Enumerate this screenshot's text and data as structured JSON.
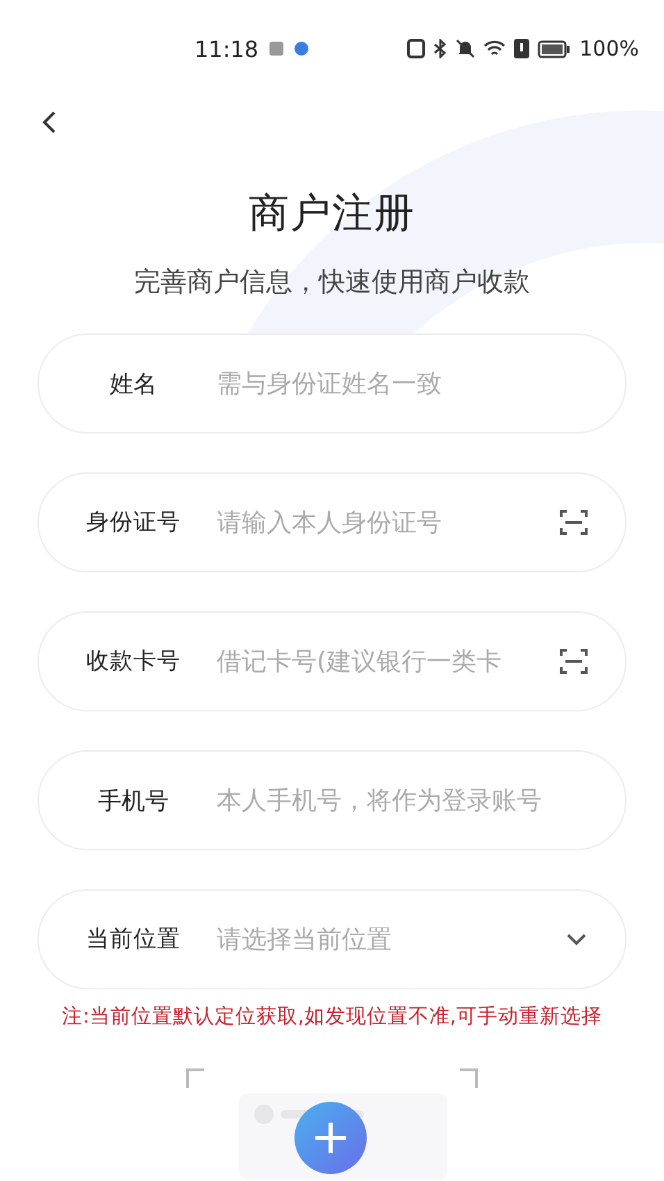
{
  "status_bar": {
    "time": "11:18",
    "battery": "100%"
  },
  "title": "商户注册",
  "subtitle": "完善商户信息，快速使用商户收款",
  "fields": [
    {
      "label": "姓名",
      "placeholder": "需与身份证姓名一致",
      "kind": "text"
    },
    {
      "label": "身份证号",
      "placeholder": "请输入本人身份证号",
      "kind": "scan"
    },
    {
      "label": "收款卡号",
      "placeholder": "借记卡号(建议银行一类卡",
      "kind": "scan"
    },
    {
      "label": "手机号",
      "placeholder": "本人手机号，将作为登录账号",
      "kind": "text"
    },
    {
      "label": "当前位置",
      "placeholder": "请选择当前位置",
      "kind": "select"
    }
  ],
  "note": "注:当前位置默认定位获取,如发现位置不准,可手动重新选择"
}
